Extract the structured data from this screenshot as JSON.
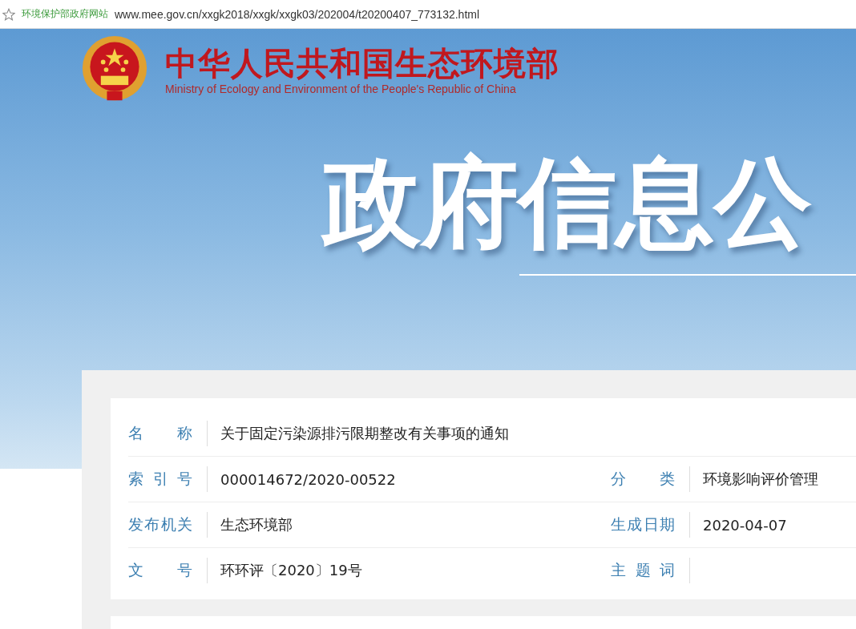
{
  "address_bar": {
    "site_name": "环境保护部政府网站",
    "url": "www.mee.gov.cn/xxgk2018/xxgk/xxgk03/202004/t20200407_773132.html"
  },
  "header": {
    "title": "中华人民共和国生态环境部",
    "subtitle": "Ministry of Ecology and Environment of the People's Republic of China"
  },
  "banner": {
    "heading": "政府信息公"
  },
  "info_table": {
    "rows": [
      [
        {
          "label": "名称",
          "value": "关于固定污染源排污限期整改有关事项的通知"
        }
      ],
      [
        {
          "label": "索引号",
          "value": "000014672/2020-00522"
        },
        {
          "label": "分类",
          "value": "环境影响评价管理"
        }
      ],
      [
        {
          "label": "发布机关",
          "value": "生态环境部"
        },
        {
          "label": "生成日期",
          "value": "2020-04-07"
        }
      ],
      [
        {
          "label": "文号",
          "value": "环环评〔2020〕19号"
        },
        {
          "label": "主题词"
        }
      ]
    ]
  }
}
